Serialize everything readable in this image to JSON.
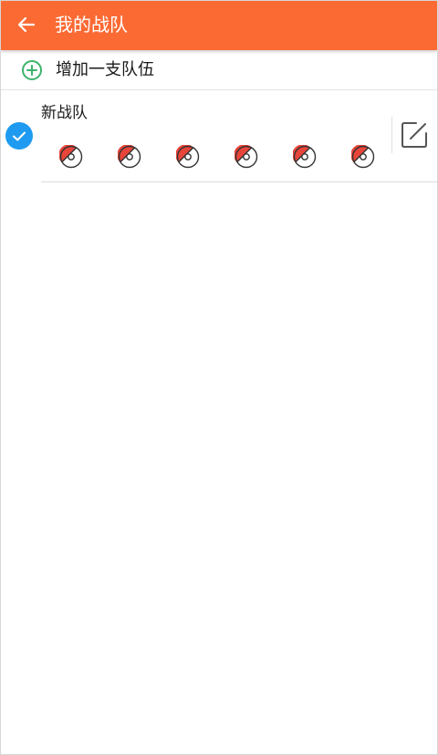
{
  "appbar": {
    "title": "我的战队",
    "background": "#fc6a34",
    "back_icon": "arrow-left-icon"
  },
  "add_team": {
    "label": "增加一支队伍",
    "icon": "plus-circle-icon",
    "icon_color": "#3db36b"
  },
  "teams": [
    {
      "name": "新战队",
      "selected": true,
      "check_color": "#1e9bf0",
      "slot_count": 6,
      "slot_icon": "pokeball-icon",
      "edit_icon": "edit-icon"
    }
  ]
}
